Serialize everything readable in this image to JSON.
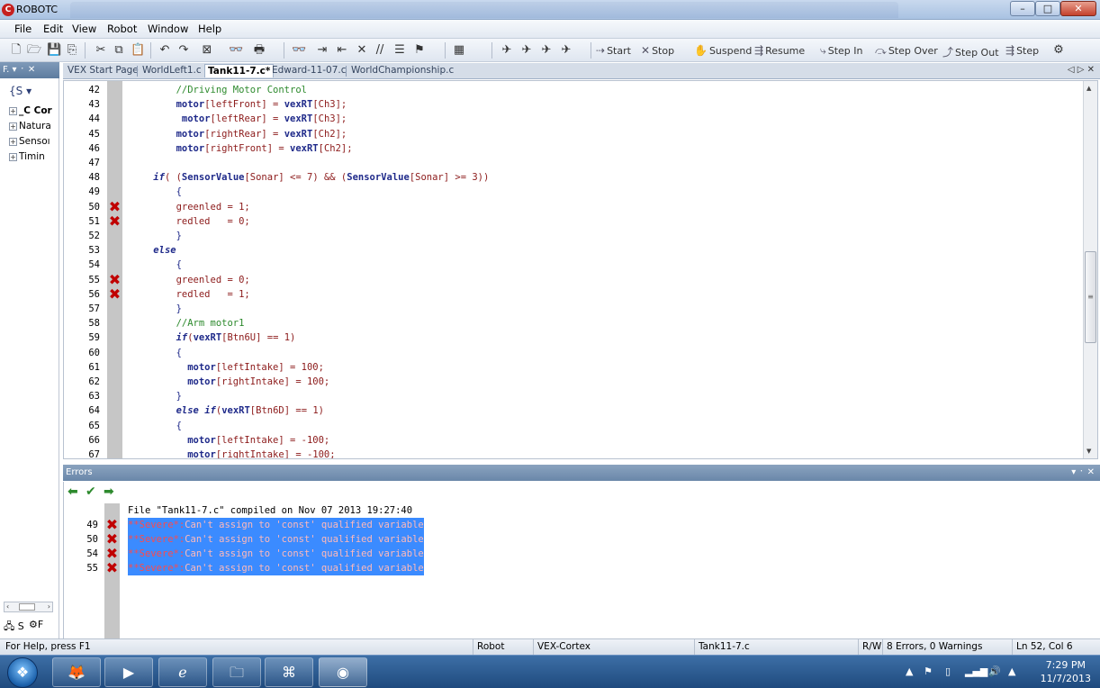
{
  "window": {
    "title": "ROBOTC",
    "min_label": "–",
    "max_label": "□",
    "close_label": "✕"
  },
  "menu": [
    "File",
    "Edit",
    "View",
    "Robot",
    "Window",
    "Help"
  ],
  "toolbar": {
    "start": "Start",
    "stop": "Stop",
    "suspend": "Suspend",
    "resume": "Resume",
    "step_in": "Step In",
    "step_over": "Step Over",
    "step_out": "Step Out",
    "step": "Step"
  },
  "left_panel": {
    "header": "F. ▾ ᛫ ✕",
    "dropdown": "{S ▾",
    "tree": [
      "_C Cor",
      "Natura",
      "Sensoı",
      "Timin"
    ],
    "scroll_left": "‹",
    "scroll_right": "›",
    "tab_1": "S",
    "tab_2": "F"
  },
  "doc_tabs": {
    "tabs": [
      "VEX Start Page",
      "WorldLeft1.c",
      "Tank11-7.c*",
      "Edward-11-07.c",
      "WorldChampionship.c"
    ],
    "active_index": 2,
    "nav_left": "◁",
    "nav_right": "▷",
    "close": "✕"
  },
  "editor": {
    "lines": [
      {
        "n": "42",
        "err": false,
        "code": "        //Driving Motor Control"
      },
      {
        "n": "43",
        "err": false,
        "code": "        motor[leftFront] = vexRT[Ch3];"
      },
      {
        "n": "44",
        "err": false,
        "code": "         motor[leftRear] = vexRT[Ch3];"
      },
      {
        "n": "45",
        "err": false,
        "code": "        motor[rightRear] = vexRT[Ch2];"
      },
      {
        "n": "46",
        "err": false,
        "code": "        motor[rightFront] = vexRT[Ch2];"
      },
      {
        "n": "47",
        "err": false,
        "code": ""
      },
      {
        "n": "48",
        "err": false,
        "code": "    if( (SensorValue[Sonar] <= 7) && (SensorValue[Sonar] >= 3))"
      },
      {
        "n": "49",
        "err": false,
        "code": "        {"
      },
      {
        "n": "50",
        "err": true,
        "code": "        greenled = 1;"
      },
      {
        "n": "51",
        "err": true,
        "code": "        redled   = 0;"
      },
      {
        "n": "52",
        "err": false,
        "code": "        }"
      },
      {
        "n": "53",
        "err": false,
        "code": "    else"
      },
      {
        "n": "54",
        "err": false,
        "code": "        {"
      },
      {
        "n": "55",
        "err": true,
        "code": "        greenled = 0;"
      },
      {
        "n": "56",
        "err": true,
        "code": "        redled   = 1;"
      },
      {
        "n": "57",
        "err": false,
        "code": "        }"
      },
      {
        "n": "58",
        "err": false,
        "code": "        //Arm motor1"
      },
      {
        "n": "59",
        "err": false,
        "code": "        if(vexRT[Btn6U] == 1)"
      },
      {
        "n": "60",
        "err": false,
        "code": "        {"
      },
      {
        "n": "61",
        "err": false,
        "code": "          motor[leftIntake] = 100;"
      },
      {
        "n": "62",
        "err": false,
        "code": "          motor[rightIntake] = 100;"
      },
      {
        "n": "63",
        "err": false,
        "code": "        }"
      },
      {
        "n": "64",
        "err": false,
        "code": "        else if(vexRT[Btn6D] == 1)"
      },
      {
        "n": "65",
        "err": false,
        "code": "        {"
      },
      {
        "n": "66",
        "err": false,
        "code": "          motor[leftIntake] = -100;"
      },
      {
        "n": "67",
        "err": false,
        "code": "          motor[rightIntake] = -100;"
      }
    ]
  },
  "errors_panel": {
    "title": "Errors",
    "controls": "▾ ᛫ ✕",
    "compile_info": "File \"Tank11-7.c\" compiled on Nov 07 2013 19:27:40",
    "entries": [
      {
        "line": "49",
        "severity": "**Severe*:",
        "message": "Can't assign to 'const' qualified variable"
      },
      {
        "line": "50",
        "severity": "**Severe*:",
        "message": "Can't assign to 'const' qualified variable"
      },
      {
        "line": "54",
        "severity": "**Severe*:",
        "message": "Can't assign to 'const' qualified variable"
      },
      {
        "line": "55",
        "severity": "**Severe*:",
        "message": "Can't assign to 'const' qualified variable"
      }
    ]
  },
  "status_bar": {
    "help": "For Help, press F1",
    "robot": "Robot",
    "platform": "VEX-Cortex",
    "file": "Tank11-7.c",
    "mode": "R/W",
    "errors": "8 Errors, 0 Warnings",
    "position": "Ln 52, Col 6"
  },
  "taskbar": {
    "time": "7:29 PM",
    "date": "11/7/2013"
  },
  "colors": {
    "keyword": "#1f2a8a",
    "comment": "#2d8a2d",
    "identifier": "#8c1a1a",
    "error_mark": "#c00000",
    "selection": "#3b8bff"
  }
}
